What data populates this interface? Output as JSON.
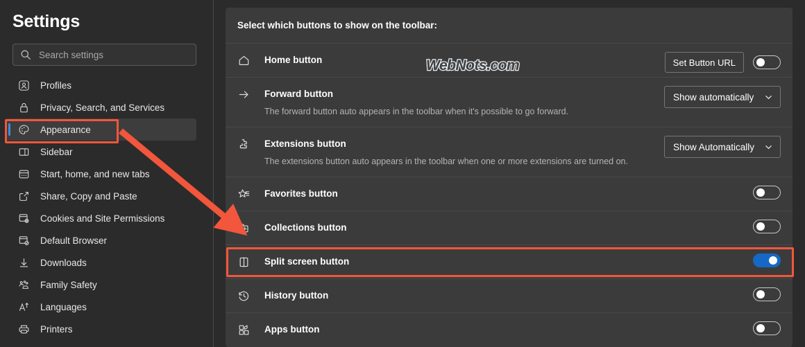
{
  "sidebar": {
    "title": "Settings",
    "search": {
      "placeholder": "Search settings",
      "value": "",
      "icon": "search-icon"
    },
    "items": [
      {
        "label": "Profiles",
        "icon": "profile-icon",
        "selected": false
      },
      {
        "label": "Privacy, Search, and Services",
        "icon": "lock-icon",
        "selected": false
      },
      {
        "label": "Appearance",
        "icon": "palette-icon",
        "selected": true
      },
      {
        "label": "Sidebar",
        "icon": "sidebar-icon",
        "selected": false
      },
      {
        "label": "Start, home, and new tabs",
        "icon": "home-tabs-icon",
        "selected": false
      },
      {
        "label": "Share, Copy and Paste",
        "icon": "share-icon",
        "selected": false
      },
      {
        "label": "Cookies and Site Permissions",
        "icon": "cookie-permissions-icon",
        "selected": false
      },
      {
        "label": "Default Browser",
        "icon": "default-browser-icon",
        "selected": false
      },
      {
        "label": "Downloads",
        "icon": "download-icon",
        "selected": false
      },
      {
        "label": "Family Safety",
        "icon": "family-icon",
        "selected": false
      },
      {
        "label": "Languages",
        "icon": "language-icon",
        "selected": false
      },
      {
        "label": "Printers",
        "icon": "printer-icon",
        "selected": false
      }
    ]
  },
  "main": {
    "header": "Select which buttons to show on the toolbar:",
    "rows": [
      {
        "title": "Home button",
        "desc": "",
        "icon": "home-icon",
        "control": "button+toggle",
        "button_label": "Set Button URL",
        "toggle_on": false
      },
      {
        "title": "Forward button",
        "desc": "The forward button auto appears in the toolbar when it's possible to go forward.",
        "icon": "arrow-right-icon",
        "control": "select",
        "select_value": "Show automatically"
      },
      {
        "title": "Extensions button",
        "desc": "The extensions button auto appears in the toolbar when one or more extensions are turned on.",
        "icon": "extensions-puzzle-icon",
        "control": "select",
        "select_value": "Show Automatically"
      },
      {
        "title": "Favorites button",
        "desc": "",
        "icon": "favorites-star-icon",
        "control": "toggle",
        "toggle_on": false
      },
      {
        "title": "Collections button",
        "desc": "",
        "icon": "collections-icon",
        "control": "toggle",
        "toggle_on": false
      },
      {
        "title": "Split screen button",
        "desc": "",
        "icon": "split-screen-icon",
        "control": "toggle",
        "toggle_on": true
      },
      {
        "title": "History button",
        "desc": "",
        "icon": "history-clock-icon",
        "control": "toggle",
        "toggle_on": false
      },
      {
        "title": "Apps button",
        "desc": "",
        "icon": "apps-grid-icon",
        "control": "toggle",
        "toggle_on": false
      }
    ]
  },
  "watermark": {
    "text": "WebNots.com"
  },
  "annotations": {
    "highlight_color": "#f2563c",
    "appearance_box": "Appearance",
    "split_screen_box": "Split screen button",
    "arrow": "red-arrow-pointing-to-settings-panel"
  },
  "colors": {
    "accent_blue": "#1668c4",
    "selection_bar": "#3b8fe0",
    "annotation_red": "#f2563c",
    "page_bg": "#2b2b2b",
    "card_bg": "#3b3b3b"
  }
}
